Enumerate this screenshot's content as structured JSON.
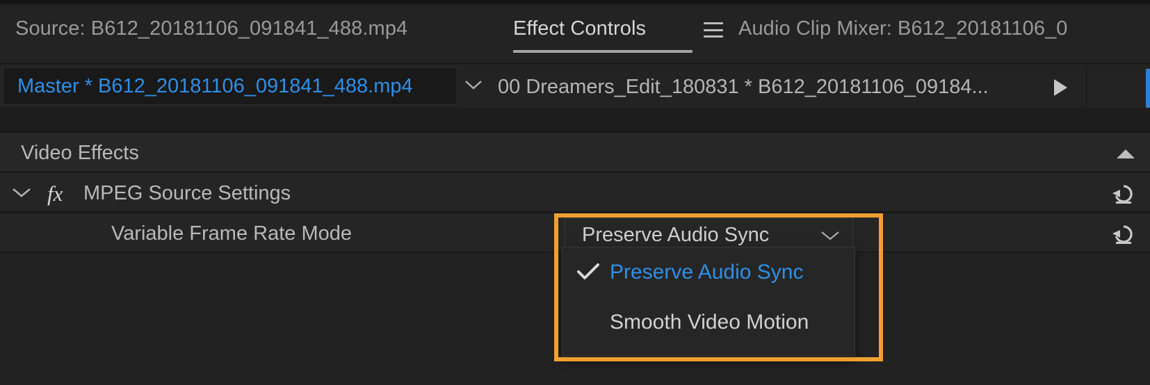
{
  "app": {
    "theme_bg": "#232323",
    "accent_blue": "#2f8fe8",
    "highlight_orange": "#f0a030"
  },
  "tabbar": {
    "tabs": [
      {
        "label": "Source: B612_20181106_091841_488.mp4",
        "active": false,
        "name": "tab-source"
      },
      {
        "label": "Effect Controls",
        "active": true,
        "name": "tab-effect-controls"
      },
      {
        "label": "Audio Clip Mixer: B612_20181106_0",
        "active": false,
        "name": "tab-audio-clip-mixer"
      }
    ],
    "menu_icon": "hamburger-menu-icon"
  },
  "clip_row": {
    "master_label": "Master * B612_20181106_091841_488.mp4",
    "dropdown_icon": "chevron-down-icon",
    "sequence_label": "00 Dreamers_Edit_180831 * B612_20181106_09184...",
    "play_icon": "play-triangle-icon"
  },
  "effects": {
    "section_title": "Video Effects",
    "collapse_icon": "triangle-up-icon",
    "rows": [
      {
        "name": "mpeg-source-settings",
        "label": "MPEG Source Settings",
        "expand_icon": "chevron-down-icon",
        "fx_icon": "fx-icon",
        "fx_label": "fx",
        "reset_icon": "reset-icon"
      },
      {
        "name": "variable-frame-rate-mode",
        "label": "Variable Frame Rate Mode",
        "reset_icon": "reset-icon"
      }
    ]
  },
  "vfr_select": {
    "value": "Preserve Audio Sync",
    "chevron_icon": "chevron-down-icon",
    "options": [
      {
        "label": "Preserve Audio Sync",
        "selected": true,
        "check_icon": "checkmark-icon"
      },
      {
        "label": "Smooth Video Motion",
        "selected": false
      }
    ]
  }
}
